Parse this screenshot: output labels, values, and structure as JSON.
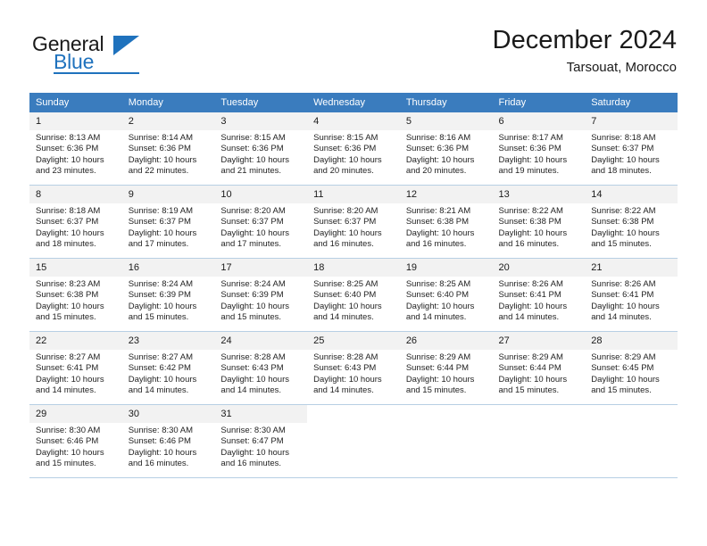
{
  "brand": {
    "name_top": "General",
    "name_bottom": "Blue"
  },
  "header": {
    "title": "December 2024",
    "location": "Tarsouat, Morocco"
  },
  "colors": {
    "header_row": "#3a7cbe",
    "brand_blue": "#1f72bd",
    "grid_line": "#b7cfe4",
    "daynum_bg": "#f2f2f2"
  },
  "weekday_headers": [
    "Sunday",
    "Monday",
    "Tuesday",
    "Wednesday",
    "Thursday",
    "Friday",
    "Saturday"
  ],
  "weeks": [
    [
      {
        "day": "1",
        "sunrise": "Sunrise: 8:13 AM",
        "sunset": "Sunset: 6:36 PM",
        "daylight1": "Daylight: 10 hours",
        "daylight2": "and 23 minutes."
      },
      {
        "day": "2",
        "sunrise": "Sunrise: 8:14 AM",
        "sunset": "Sunset: 6:36 PM",
        "daylight1": "Daylight: 10 hours",
        "daylight2": "and 22 minutes."
      },
      {
        "day": "3",
        "sunrise": "Sunrise: 8:15 AM",
        "sunset": "Sunset: 6:36 PM",
        "daylight1": "Daylight: 10 hours",
        "daylight2": "and 21 minutes."
      },
      {
        "day": "4",
        "sunrise": "Sunrise: 8:15 AM",
        "sunset": "Sunset: 6:36 PM",
        "daylight1": "Daylight: 10 hours",
        "daylight2": "and 20 minutes."
      },
      {
        "day": "5",
        "sunrise": "Sunrise: 8:16 AM",
        "sunset": "Sunset: 6:36 PM",
        "daylight1": "Daylight: 10 hours",
        "daylight2": "and 20 minutes."
      },
      {
        "day": "6",
        "sunrise": "Sunrise: 8:17 AM",
        "sunset": "Sunset: 6:36 PM",
        "daylight1": "Daylight: 10 hours",
        "daylight2": "and 19 minutes."
      },
      {
        "day": "7",
        "sunrise": "Sunrise: 8:18 AM",
        "sunset": "Sunset: 6:37 PM",
        "daylight1": "Daylight: 10 hours",
        "daylight2": "and 18 minutes."
      }
    ],
    [
      {
        "day": "8",
        "sunrise": "Sunrise: 8:18 AM",
        "sunset": "Sunset: 6:37 PM",
        "daylight1": "Daylight: 10 hours",
        "daylight2": "and 18 minutes."
      },
      {
        "day": "9",
        "sunrise": "Sunrise: 8:19 AM",
        "sunset": "Sunset: 6:37 PM",
        "daylight1": "Daylight: 10 hours",
        "daylight2": "and 17 minutes."
      },
      {
        "day": "10",
        "sunrise": "Sunrise: 8:20 AM",
        "sunset": "Sunset: 6:37 PM",
        "daylight1": "Daylight: 10 hours",
        "daylight2": "and 17 minutes."
      },
      {
        "day": "11",
        "sunrise": "Sunrise: 8:20 AM",
        "sunset": "Sunset: 6:37 PM",
        "daylight1": "Daylight: 10 hours",
        "daylight2": "and 16 minutes."
      },
      {
        "day": "12",
        "sunrise": "Sunrise: 8:21 AM",
        "sunset": "Sunset: 6:38 PM",
        "daylight1": "Daylight: 10 hours",
        "daylight2": "and 16 minutes."
      },
      {
        "day": "13",
        "sunrise": "Sunrise: 8:22 AM",
        "sunset": "Sunset: 6:38 PM",
        "daylight1": "Daylight: 10 hours",
        "daylight2": "and 16 minutes."
      },
      {
        "day": "14",
        "sunrise": "Sunrise: 8:22 AM",
        "sunset": "Sunset: 6:38 PM",
        "daylight1": "Daylight: 10 hours",
        "daylight2": "and 15 minutes."
      }
    ],
    [
      {
        "day": "15",
        "sunrise": "Sunrise: 8:23 AM",
        "sunset": "Sunset: 6:38 PM",
        "daylight1": "Daylight: 10 hours",
        "daylight2": "and 15 minutes."
      },
      {
        "day": "16",
        "sunrise": "Sunrise: 8:24 AM",
        "sunset": "Sunset: 6:39 PM",
        "daylight1": "Daylight: 10 hours",
        "daylight2": "and 15 minutes."
      },
      {
        "day": "17",
        "sunrise": "Sunrise: 8:24 AM",
        "sunset": "Sunset: 6:39 PM",
        "daylight1": "Daylight: 10 hours",
        "daylight2": "and 15 minutes."
      },
      {
        "day": "18",
        "sunrise": "Sunrise: 8:25 AM",
        "sunset": "Sunset: 6:40 PM",
        "daylight1": "Daylight: 10 hours",
        "daylight2": "and 14 minutes."
      },
      {
        "day": "19",
        "sunrise": "Sunrise: 8:25 AM",
        "sunset": "Sunset: 6:40 PM",
        "daylight1": "Daylight: 10 hours",
        "daylight2": "and 14 minutes."
      },
      {
        "day": "20",
        "sunrise": "Sunrise: 8:26 AM",
        "sunset": "Sunset: 6:41 PM",
        "daylight1": "Daylight: 10 hours",
        "daylight2": "and 14 minutes."
      },
      {
        "day": "21",
        "sunrise": "Sunrise: 8:26 AM",
        "sunset": "Sunset: 6:41 PM",
        "daylight1": "Daylight: 10 hours",
        "daylight2": "and 14 minutes."
      }
    ],
    [
      {
        "day": "22",
        "sunrise": "Sunrise: 8:27 AM",
        "sunset": "Sunset: 6:41 PM",
        "daylight1": "Daylight: 10 hours",
        "daylight2": "and 14 minutes."
      },
      {
        "day": "23",
        "sunrise": "Sunrise: 8:27 AM",
        "sunset": "Sunset: 6:42 PM",
        "daylight1": "Daylight: 10 hours",
        "daylight2": "and 14 minutes."
      },
      {
        "day": "24",
        "sunrise": "Sunrise: 8:28 AM",
        "sunset": "Sunset: 6:43 PM",
        "daylight1": "Daylight: 10 hours",
        "daylight2": "and 14 minutes."
      },
      {
        "day": "25",
        "sunrise": "Sunrise: 8:28 AM",
        "sunset": "Sunset: 6:43 PM",
        "daylight1": "Daylight: 10 hours",
        "daylight2": "and 14 minutes."
      },
      {
        "day": "26",
        "sunrise": "Sunrise: 8:29 AM",
        "sunset": "Sunset: 6:44 PM",
        "daylight1": "Daylight: 10 hours",
        "daylight2": "and 15 minutes."
      },
      {
        "day": "27",
        "sunrise": "Sunrise: 8:29 AM",
        "sunset": "Sunset: 6:44 PM",
        "daylight1": "Daylight: 10 hours",
        "daylight2": "and 15 minutes."
      },
      {
        "day": "28",
        "sunrise": "Sunrise: 8:29 AM",
        "sunset": "Sunset: 6:45 PM",
        "daylight1": "Daylight: 10 hours",
        "daylight2": "and 15 minutes."
      }
    ],
    [
      {
        "day": "29",
        "sunrise": "Sunrise: 8:30 AM",
        "sunset": "Sunset: 6:46 PM",
        "daylight1": "Daylight: 10 hours",
        "daylight2": "and 15 minutes."
      },
      {
        "day": "30",
        "sunrise": "Sunrise: 8:30 AM",
        "sunset": "Sunset: 6:46 PM",
        "daylight1": "Daylight: 10 hours",
        "daylight2": "and 16 minutes."
      },
      {
        "day": "31",
        "sunrise": "Sunrise: 8:30 AM",
        "sunset": "Sunset: 6:47 PM",
        "daylight1": "Daylight: 10 hours",
        "daylight2": "and 16 minutes."
      },
      {
        "day": "",
        "sunrise": "",
        "sunset": "",
        "daylight1": "",
        "daylight2": ""
      },
      {
        "day": "",
        "sunrise": "",
        "sunset": "",
        "daylight1": "",
        "daylight2": ""
      },
      {
        "day": "",
        "sunrise": "",
        "sunset": "",
        "daylight1": "",
        "daylight2": ""
      },
      {
        "day": "",
        "sunrise": "",
        "sunset": "",
        "daylight1": "",
        "daylight2": ""
      }
    ]
  ]
}
